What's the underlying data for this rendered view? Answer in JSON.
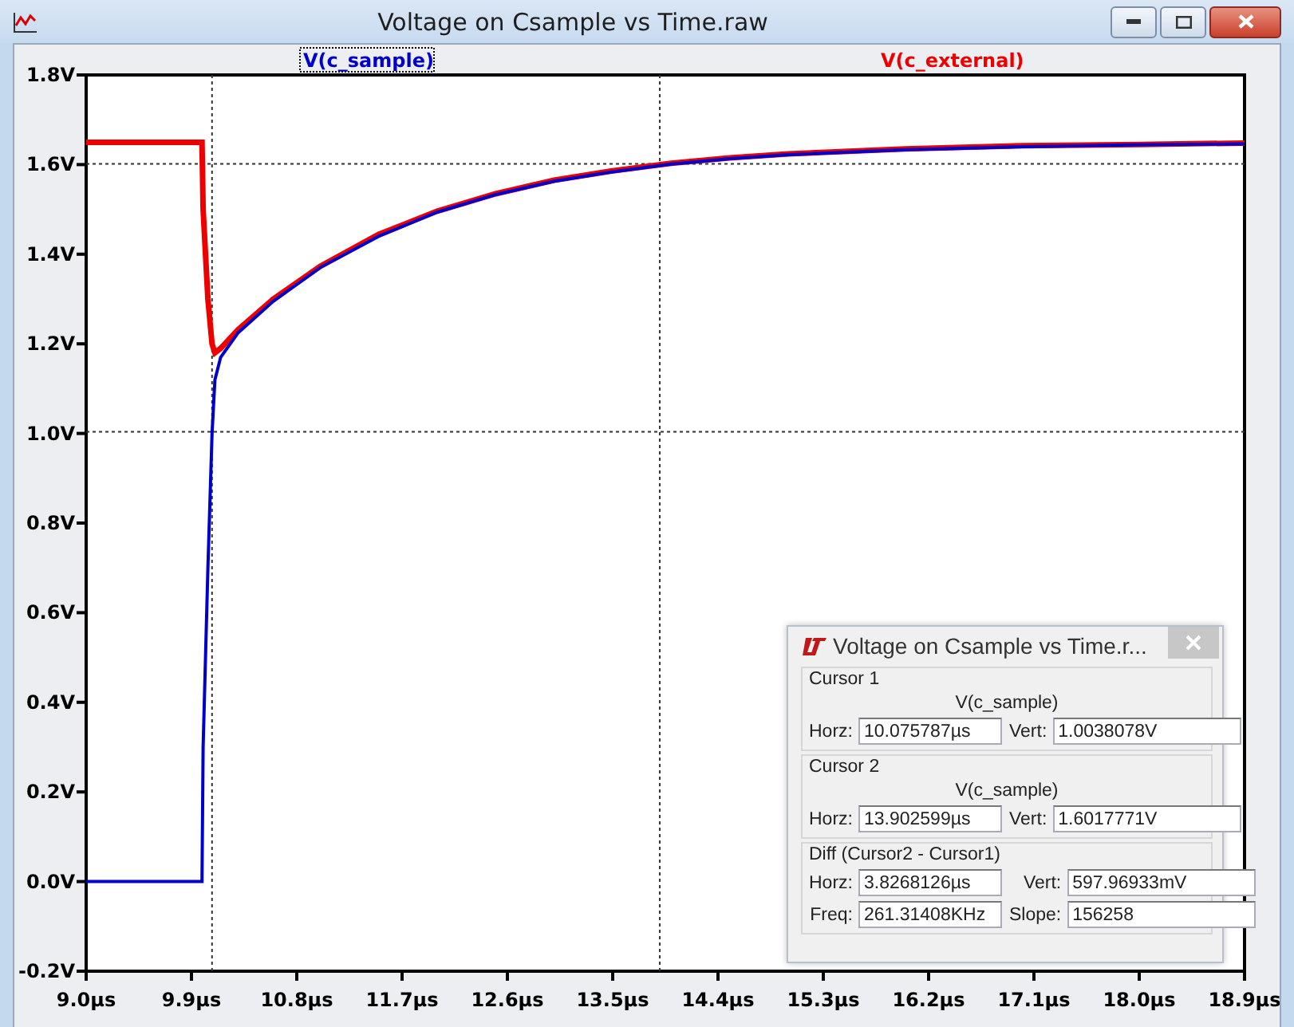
{
  "window": {
    "title": "Voltage on Csample vs Time.raw"
  },
  "trace_labels": [
    {
      "selected": true
    },
    {
      "selected": false
    }
  ],
  "chart_data": {
    "type": "line",
    "x": [
      9.0,
      9.99,
      10.0,
      10.04,
      10.076,
      10.1,
      10.15,
      10.3,
      10.6,
      11.0,
      11.5,
      12.0,
      12.5,
      13.0,
      13.5,
      14.0,
      14.5,
      15.0,
      16.0,
      17.0,
      18.0,
      18.9
    ],
    "series": [
      {
        "name": "V(c_sample)",
        "color": "#0000cc",
        "values": [
          0,
          0,
          0.3,
          0.7,
          1.0,
          1.12,
          1.17,
          1.225,
          1.295,
          1.37,
          1.44,
          1.494,
          1.533,
          1.563,
          1.584,
          1.601,
          1.613,
          1.622,
          1.633,
          1.64,
          1.644,
          1.646
        ]
      },
      {
        "name": "V(c_external)",
        "color": "#ee0000",
        "values": [
          1.65,
          1.65,
          1.5,
          1.3,
          1.2,
          1.18,
          1.19,
          1.232,
          1.3,
          1.373,
          1.444,
          1.496,
          1.535,
          1.565,
          1.586,
          1.603,
          1.615,
          1.624,
          1.635,
          1.642,
          1.645,
          1.648
        ]
      }
    ],
    "xlim": [
      9.0,
      18.9
    ],
    "ylim": [
      -0.2,
      1.8
    ],
    "xticks": [
      {
        "value": 9.0,
        "label": "9.0µs"
      },
      {
        "value": 9.9,
        "label": "9.9µs"
      },
      {
        "value": 10.8,
        "label": "10.8µs"
      },
      {
        "value": 11.7,
        "label": "11.7µs"
      },
      {
        "value": 12.6,
        "label": "12.6µs"
      },
      {
        "value": 13.5,
        "label": "13.5µs"
      },
      {
        "value": 14.4,
        "label": "14.4µs"
      },
      {
        "value": 15.3,
        "label": "15.3µs"
      },
      {
        "value": 16.2,
        "label": "16.2µs"
      },
      {
        "value": 17.1,
        "label": "17.1µs"
      },
      {
        "value": 18.0,
        "label": "18.0µs"
      },
      {
        "value": 18.9,
        "label": "18.9µs"
      }
    ],
    "yticks": [
      {
        "value": 1.8,
        "label": "1.8V"
      },
      {
        "value": 1.6,
        "label": "1.6V"
      },
      {
        "value": 1.4,
        "label": "1.4V"
      },
      {
        "value": 1.2,
        "label": "1.2V"
      },
      {
        "value": 1.0,
        "label": "1.0V"
      },
      {
        "value": 0.8,
        "label": "0.8V"
      },
      {
        "value": 0.6,
        "label": "0.6V"
      },
      {
        "value": 0.4,
        "label": "0.4V"
      },
      {
        "value": 0.2,
        "label": "0.2V"
      },
      {
        "value": 0.0,
        "label": "0.0V"
      },
      {
        "value": -0.2,
        "label": "-0.2V"
      }
    ]
  },
  "cursor_dialog": {
    "title": "Voltage on Csample vs Time.r...",
    "groups": [
      {
        "title": "Cursor 1",
        "trace": "V(c_sample)",
        "fields": [
          {
            "label": "Horz:",
            "value": "10.075787µs"
          },
          {
            "label": "Vert:",
            "value": "1.0038078V"
          }
        ]
      },
      {
        "title": "Cursor 2",
        "trace": "V(c_sample)",
        "fields": [
          {
            "label": "Horz:",
            "value": "13.902599µs"
          },
          {
            "label": "Vert:",
            "value": "1.6017771V"
          }
        ]
      },
      {
        "title": "Diff (Cursor2 - Cursor1)",
        "fields": [
          {
            "label": "Horz:",
            "value": "3.8268126µs"
          },
          {
            "label": "Vert:",
            "value": "597.96933mV"
          },
          {
            "label": "Freq:",
            "value": "261.31408KHz"
          },
          {
            "label": "Slope:",
            "value": "156258"
          }
        ]
      }
    ]
  }
}
